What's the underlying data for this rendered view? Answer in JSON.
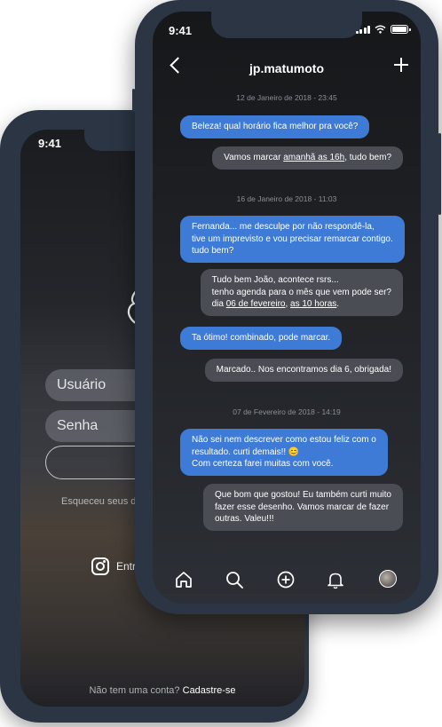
{
  "login_screen": {
    "time": "9:41",
    "username_placeholder": "Usuário",
    "password_placeholder": "Senha",
    "forgot_text": "Esqueceu seus da",
    "instagram_label": "Entr",
    "signup_question": "Não tem uma conta?",
    "signup_link": "Cadastre-se"
  },
  "chat_screen": {
    "time": "9:41",
    "title": "jp.matumoto",
    "messages": [
      {
        "type": "date",
        "text": "12 de Janeiro de 2018 - 23:45"
      },
      {
        "type": "me",
        "lines": [
          "Beleza! qual horário fica melhor pra você?"
        ]
      },
      {
        "type": "them",
        "lines": [
          "Vamos marcar amanhã as 16h, tudo bem?"
        ]
      },
      {
        "type": "date",
        "text": "16 de Janeiro de 2018 - 11:03"
      },
      {
        "type": "me",
        "lines": [
          "Fernanda... me desculpe por não respondê-la,",
          "tive um imprevisto e vou precisar remarcar contigo.",
          "tudo bem?"
        ]
      },
      {
        "type": "them",
        "lines": [
          "Tudo bem João, acontece rsrs...",
          "tenho agenda para o mês que vem pode ser?",
          "dia 06 de fevereiro, as 10 horas."
        ]
      },
      {
        "type": "me",
        "lines": [
          "Ta ótimo! combinado, pode marcar."
        ]
      },
      {
        "type": "them",
        "lines": [
          "Marcado.. Nos encontramos dia 6, obrigada!"
        ]
      },
      {
        "type": "date",
        "text": "07 de Fevereiro de 2018 - 14:19"
      },
      {
        "type": "me",
        "lines": [
          "Não sei nem descrever como estou feliz com o",
          "resultado. curti demais!! 😊",
          "Com certeza farei muitas com você."
        ]
      },
      {
        "type": "them",
        "lines": [
          "Que bom que gostou! Eu também curti muito",
          "fazer esse desenho. Vamos marcar de fazer",
          "outras. Valeu!!!"
        ]
      }
    ],
    "tabbar_icons": [
      "home-icon",
      "search-icon",
      "add-icon",
      "notifications-icon",
      "profile-avatar"
    ]
  },
  "colors": {
    "frame": "#2b3544",
    "my_bubble": "#3e7bd6",
    "their_bubble": "#4a4d54"
  }
}
